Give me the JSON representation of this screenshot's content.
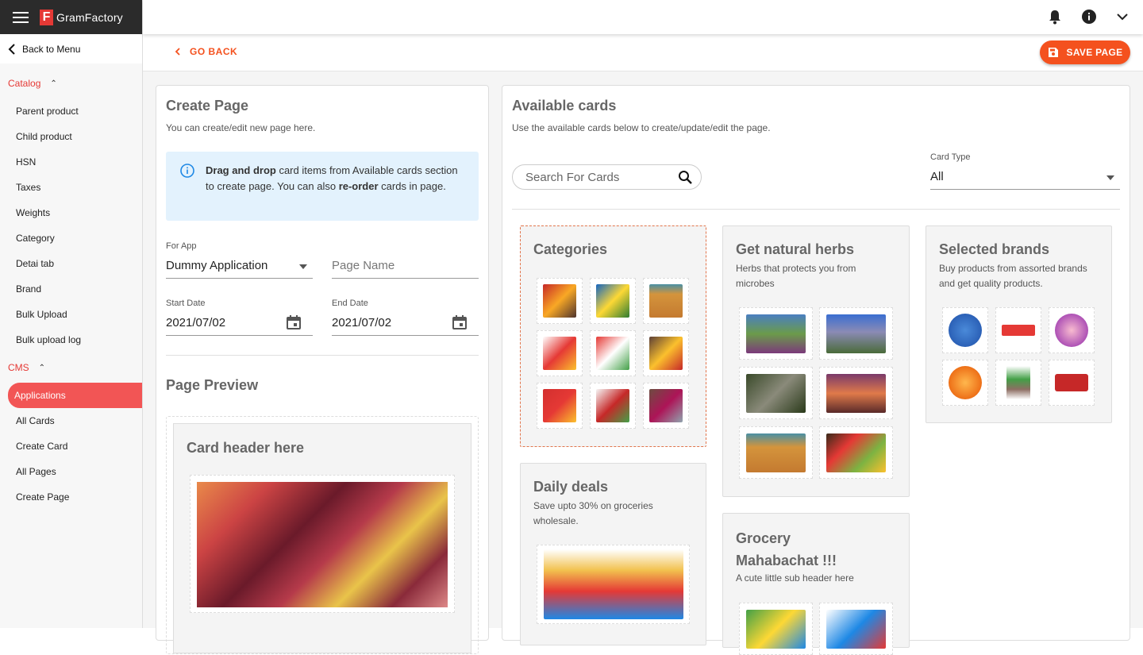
{
  "app": {
    "brand": "GramFactory"
  },
  "sidebar": {
    "back": "Back to Menu",
    "catalog_label": "Catalog",
    "catalog_items": [
      "Parent product",
      "Child product",
      "HSN",
      "Taxes",
      "Weights",
      "Category",
      "Detai tab",
      "Brand",
      "Bulk Upload",
      "Bulk upload log"
    ],
    "cms_label": "CMS",
    "cms_items": [
      "Applications",
      "All Cards",
      "Create Card",
      "All Pages",
      "Create Page"
    ],
    "active_item": "Applications"
  },
  "toolbar": {
    "go_back": "GO BACK",
    "save": "SAVE PAGE"
  },
  "create_page": {
    "title": "Create Page",
    "subtitle": "You can create/edit new page here.",
    "info_bold1": "Drag and drop",
    "info_text1": " card items from Available cards section to create page. You can also ",
    "info_bold2": "re-order",
    "info_text2": " cards in page.",
    "for_app_label": "For App",
    "for_app_value": "Dummy Application",
    "page_name_placeholder": "Page Name",
    "start_date_label": "Start Date",
    "start_date_value": "2021/07/02",
    "end_date_label": "End Date",
    "end_date_value": "2021/07/02",
    "preview_title": "Page Preview",
    "preview_card_header": "Card header here"
  },
  "available": {
    "title": "Available cards",
    "subtitle": "Use the available cards below to create/update/edit the page.",
    "search_placeholder": "Search For Cards",
    "card_type_label": "Card Type",
    "card_type_value": "All",
    "cards": [
      {
        "title": "Categories"
      },
      {
        "title": "Get natural herbs",
        "sub": "Herbs that protects you from microbes"
      },
      {
        "title": "Selected brands",
        "sub": "Buy products from assorted brands and get quality products."
      },
      {
        "title": "Daily deals",
        "sub": "Save upto 30% on groceries wholesale."
      },
      {
        "title": "Grocery Mahabachat !!!",
        "sub": "A cute little sub header here"
      }
    ]
  },
  "colors": {
    "accent": "#f4511e",
    "active": "#f25555",
    "info_bg": "#e3f2fd"
  }
}
